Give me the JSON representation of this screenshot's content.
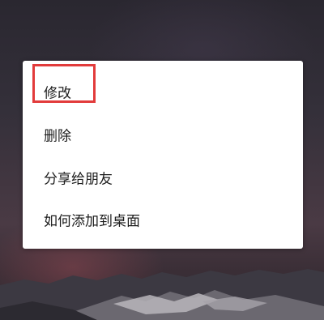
{
  "context_menu": {
    "items": [
      {
        "label": "修改",
        "highlighted": true
      },
      {
        "label": "删除",
        "highlighted": false
      },
      {
        "label": "分享给朋友",
        "highlighted": false
      },
      {
        "label": "如何添加到桌面",
        "highlighted": false
      }
    ]
  },
  "colors": {
    "menu_background": "#ffffff",
    "menu_text": "#1c1c1c",
    "highlight_border": "#e23b3b",
    "wallpaper_top": "#2a2730",
    "wallpaper_bottom": "#3a2e36"
  }
}
